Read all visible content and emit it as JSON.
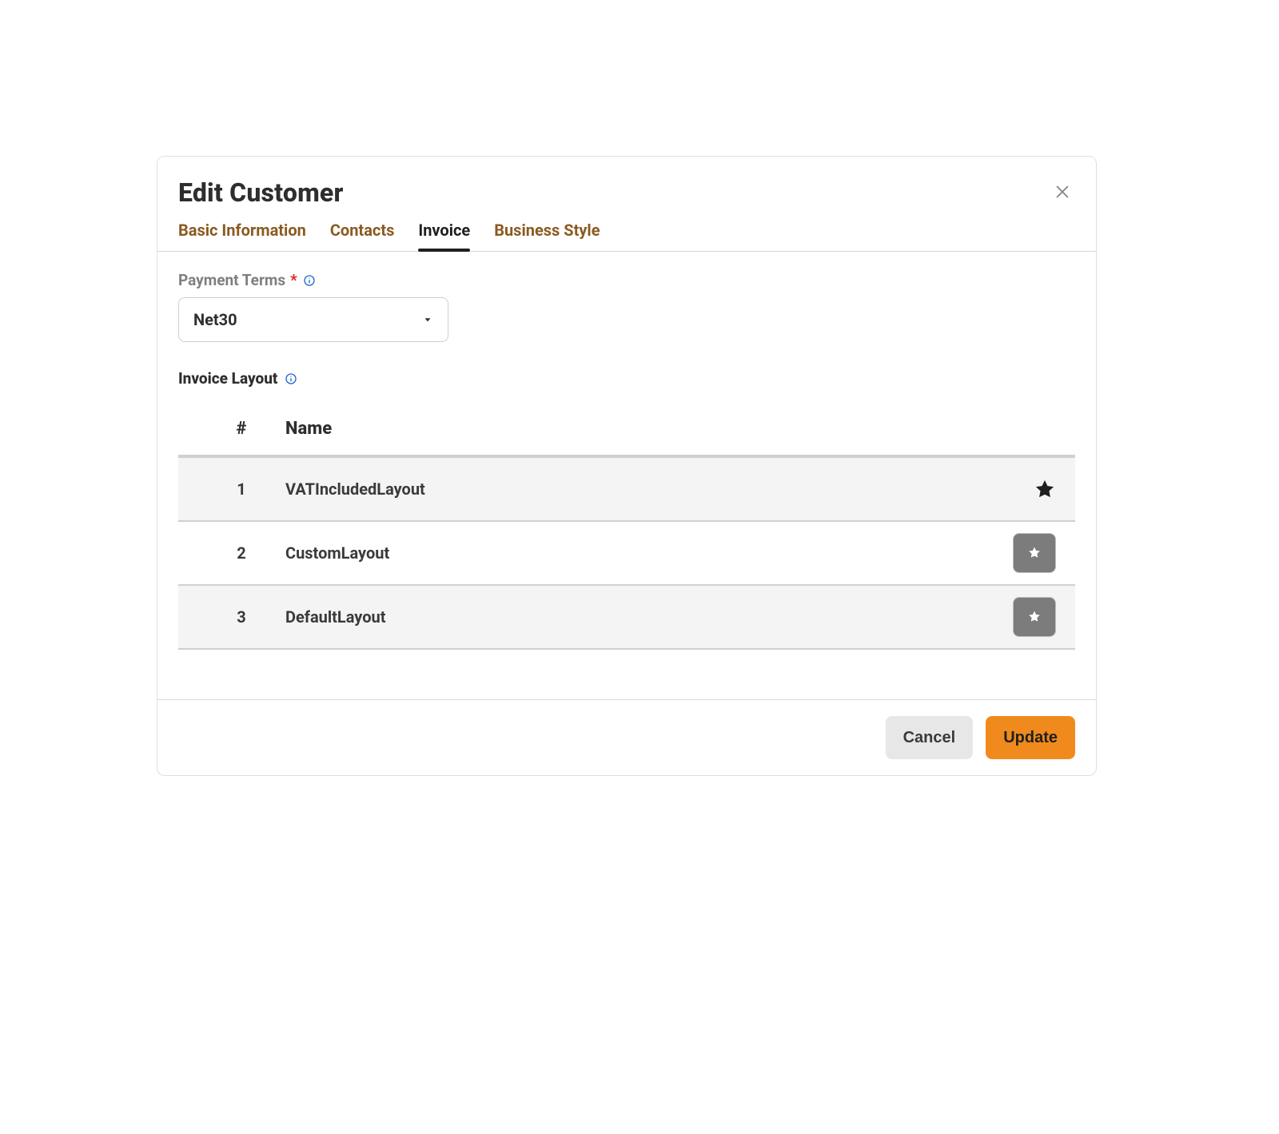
{
  "modal": {
    "title": "Edit Customer"
  },
  "tabs": [
    {
      "id": "basic",
      "label": "Basic Information",
      "active": false
    },
    {
      "id": "contacts",
      "label": "Contacts",
      "active": false
    },
    {
      "id": "invoice",
      "label": "Invoice",
      "active": true
    },
    {
      "id": "business-style",
      "label": "Business Style",
      "active": false
    }
  ],
  "form": {
    "payment_terms": {
      "label": "Payment Terms",
      "required": true,
      "value": "Net30"
    },
    "invoice_layout": {
      "label": "Invoice Layout",
      "columns": {
        "index": "#",
        "name": "Name"
      },
      "rows": [
        {
          "index": "1",
          "name": "VATIncludedLayout",
          "default": true
        },
        {
          "index": "2",
          "name": "CustomLayout",
          "default": false
        },
        {
          "index": "3",
          "name": "DefaultLayout",
          "default": false
        }
      ]
    }
  },
  "footer": {
    "cancel": "Cancel",
    "update": "Update"
  },
  "colors": {
    "accent": "#f08a1d",
    "tab_inactive": "#8a5a21"
  }
}
